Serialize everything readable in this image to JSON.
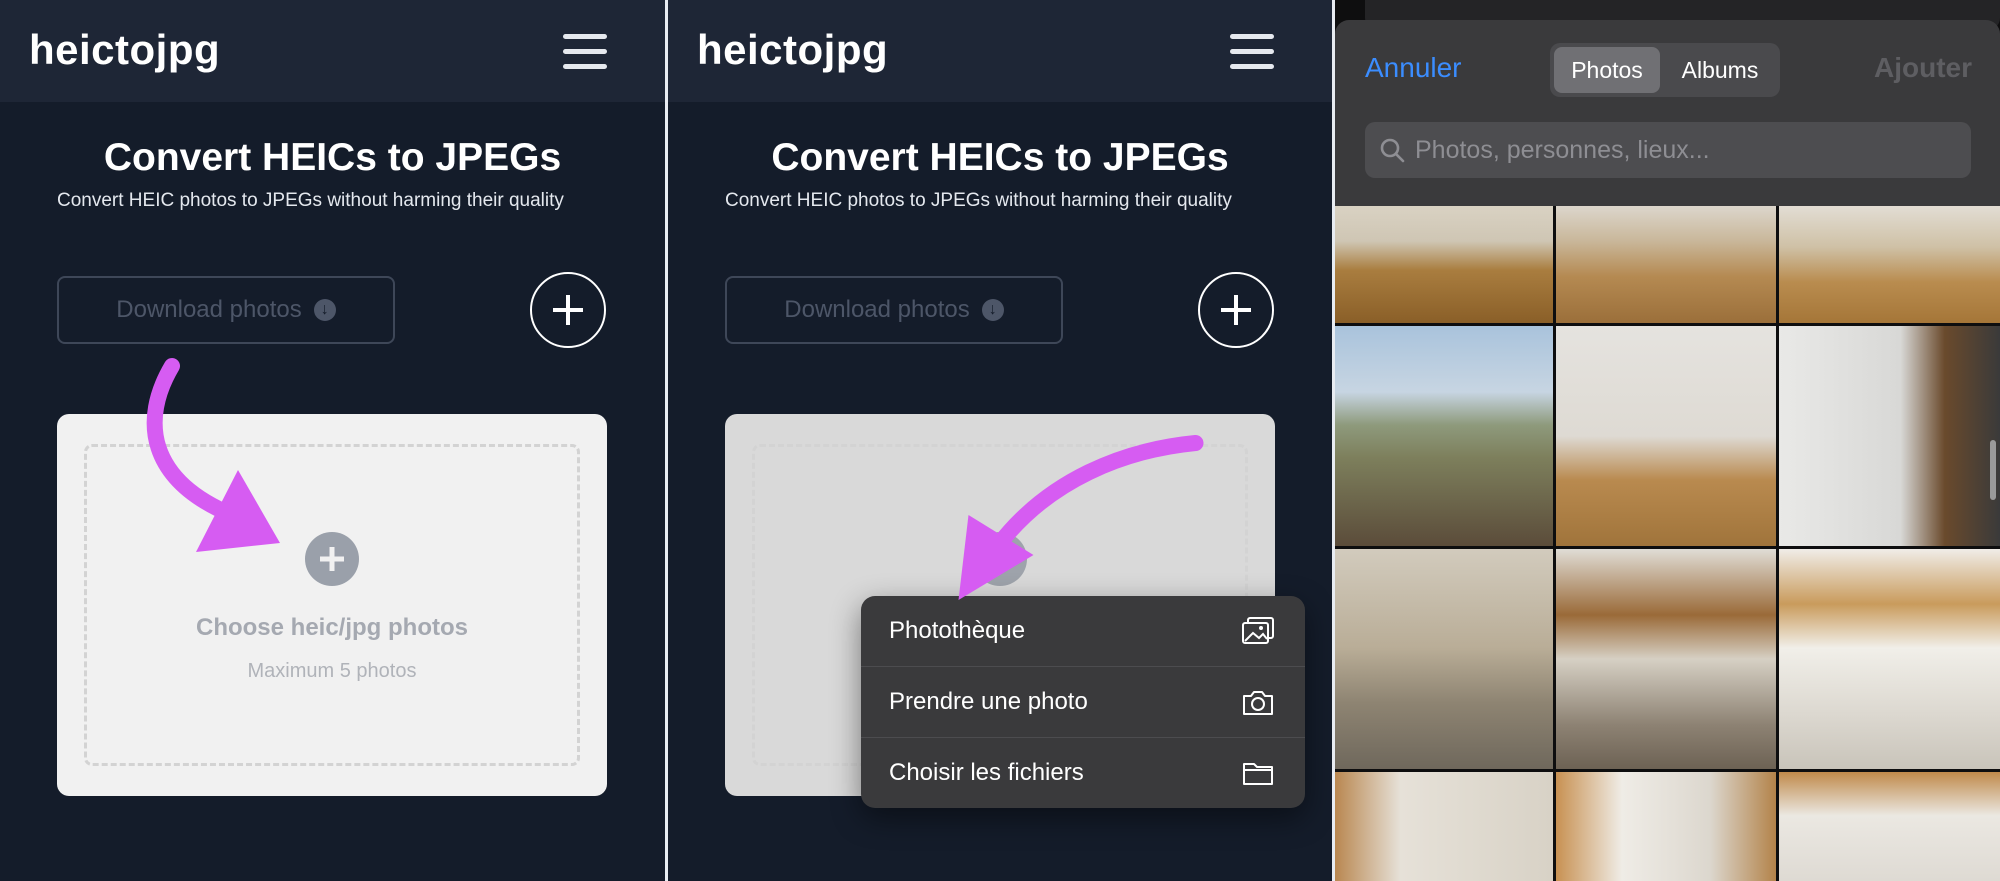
{
  "app": {
    "logo": "heictojpg",
    "title": "Convert HEICs to JPEGs",
    "subtitle": "Convert HEIC photos to JPEGs without harming their quality",
    "download_label": "Download photos",
    "dropzone_title": "Choose heic/jpg photos",
    "dropzone_sub": "Maximum 5 photos"
  },
  "action_menu": {
    "items": [
      {
        "label": "Photothèque",
        "icon": "photo-library-icon"
      },
      {
        "label": "Prendre une photo",
        "icon": "camera-icon"
      },
      {
        "label": "Choisir les fichiers",
        "icon": "folder-icon"
      }
    ]
  },
  "picker": {
    "cancel": "Annuler",
    "add": "Ajouter",
    "tabs": [
      "Photos",
      "Albums"
    ],
    "selected_tab": "Photos",
    "search_placeholder": "Photos, personnes, lieux..."
  },
  "colors": {
    "background": "#141c2a",
    "header": "#1e2636",
    "accent_arrow": "#d65cf2",
    "ios_blue": "#3b8dff"
  }
}
